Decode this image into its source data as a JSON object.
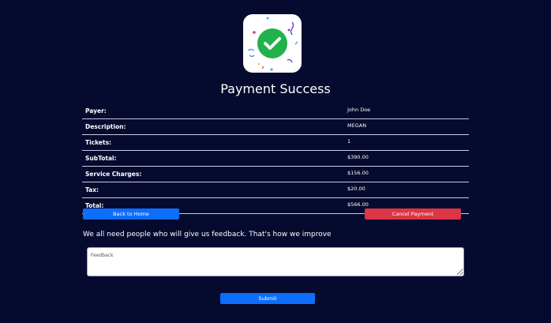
{
  "icon": "success-check-confetti-icon",
  "colors": {
    "background": "#050a2e",
    "check": "#22b14c",
    "primary_button": "#0d6efd",
    "danger_button": "#dc3545"
  },
  "title": "Payment Success",
  "summary": {
    "rows": [
      {
        "label": "Payer:",
        "value": "John Doe"
      },
      {
        "label": "Description:",
        "value": "MEGAN"
      },
      {
        "label": "Tickets:",
        "value": "1"
      },
      {
        "label": "SubTotal:",
        "value": "$390.00"
      },
      {
        "label": "Service Charges:",
        "value": "$156.00"
      },
      {
        "label": "Tax:",
        "value": "$20.00"
      },
      {
        "label": "Total:",
        "value": "$566.00"
      }
    ]
  },
  "actions": {
    "back_home": "Back to Home",
    "cancel_payment": "Cancel Payment"
  },
  "feedback": {
    "prompt": "We all need people who will give us feedback. That's how we improve",
    "placeholder": "Feedback",
    "value": "",
    "submit": "Submit"
  }
}
